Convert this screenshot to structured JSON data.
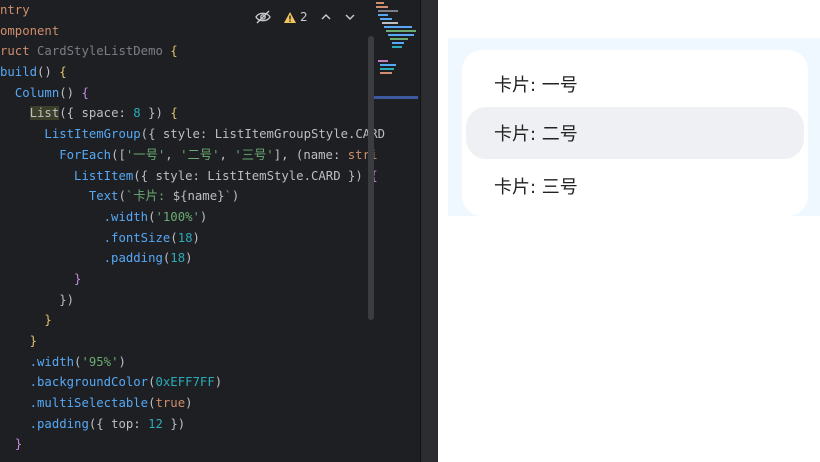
{
  "editor": {
    "toolbar": {
      "warnings_count": "2"
    },
    "lines": [
      [
        [
          "ntry",
          "kw"
        ]
      ],
      [
        [
          "omponent",
          "kw"
        ]
      ],
      [
        [
          "ruct ",
          "kw"
        ],
        [
          "CardStyleListDemo",
          "dim"
        ],
        [
          " ",
          ""
        ],
        [
          "{",
          "brace"
        ]
      ],
      [
        [
          "build",
          "fn"
        ],
        [
          "()",
          ""
        ],
        [
          " ",
          ""
        ],
        [
          "{",
          "brace"
        ]
      ],
      [
        [
          "  ",
          ""
        ],
        [
          "Column",
          "fn"
        ],
        [
          "()",
          ""
        ],
        [
          " ",
          ""
        ],
        [
          "{",
          "paren"
        ]
      ],
      [
        [
          "    ",
          ""
        ],
        [
          "List",
          "hl"
        ],
        [
          "({",
          ""
        ],
        [
          " space",
          ""
        ],
        [
          ": ",
          ""
        ],
        [
          "8",
          "num"
        ],
        [
          " })",
          ""
        ],
        [
          " ",
          ""
        ],
        [
          "{",
          "brace"
        ]
      ],
      [
        [
          "      ",
          ""
        ],
        [
          "ListItemGroup",
          "fn"
        ],
        [
          "({ ",
          ""
        ],
        [
          "style",
          ""
        ],
        [
          ": ",
          ""
        ],
        [
          "ListItemGroupStyle",
          ""
        ],
        [
          ".CARD",
          ""
        ]
      ],
      [
        [
          "        ",
          ""
        ],
        [
          "ForEach",
          "fn"
        ],
        [
          "([",
          ""
        ],
        [
          "'一号'",
          "str"
        ],
        [
          ", ",
          ""
        ],
        [
          "'二号'",
          "str"
        ],
        [
          ", ",
          ""
        ],
        [
          "'三号'",
          "str"
        ],
        [
          "], (",
          ""
        ],
        [
          "name",
          ""
        ],
        [
          ": ",
          ""
        ],
        [
          "stri",
          "kw"
        ]
      ],
      [
        [
          "          ",
          ""
        ],
        [
          "ListItem",
          "fn"
        ],
        [
          "({ ",
          ""
        ],
        [
          "style",
          ""
        ],
        [
          ": ",
          ""
        ],
        [
          "ListItemStyle",
          ""
        ],
        [
          ".CARD",
          ""
        ],
        [
          " }) ",
          ""
        ],
        [
          "{",
          "paren"
        ]
      ],
      [
        [
          "            ",
          ""
        ],
        [
          "Text",
          "fn"
        ],
        [
          "(",
          ""
        ],
        [
          "`卡片: ",
          "str"
        ],
        [
          "${name}",
          ""
        ],
        [
          "`",
          "str"
        ],
        [
          ")",
          ""
        ]
      ],
      [
        [
          "              ",
          ""
        ],
        [
          ".width",
          "fn"
        ],
        [
          "(",
          ""
        ],
        [
          "'100%'",
          "str"
        ],
        [
          ")",
          ""
        ]
      ],
      [
        [
          "              ",
          ""
        ],
        [
          ".fontSize",
          "fn"
        ],
        [
          "(",
          ""
        ],
        [
          "18",
          "num"
        ],
        [
          ")",
          ""
        ]
      ],
      [
        [
          "              ",
          ""
        ],
        [
          ".padding",
          "fn"
        ],
        [
          "(",
          ""
        ],
        [
          "18",
          "num"
        ],
        [
          ")",
          ""
        ]
      ],
      [
        [
          "          ",
          ""
        ],
        [
          "}",
          "paren"
        ]
      ],
      [
        [
          "        ",
          ""
        ],
        [
          "})",
          ""
        ]
      ],
      [
        [
          "      ",
          ""
        ],
        [
          "}",
          "brace"
        ]
      ],
      [
        [
          "    ",
          ""
        ],
        [
          "}",
          "brace"
        ]
      ],
      [
        [
          "    ",
          ""
        ],
        [
          ".width",
          "fn"
        ],
        [
          "(",
          ""
        ],
        [
          "'95%'",
          "str"
        ],
        [
          ")",
          ""
        ]
      ],
      [
        [
          "    ",
          ""
        ],
        [
          ".backgroundColor",
          "fn"
        ],
        [
          "(",
          ""
        ],
        [
          "0xEFF7FF",
          "num"
        ],
        [
          ")",
          ""
        ]
      ],
      [
        [
          "    ",
          ""
        ],
        [
          ".multiSelectable",
          "fn"
        ],
        [
          "(",
          ""
        ],
        [
          "true",
          "kw"
        ],
        [
          ")",
          ""
        ]
      ],
      [
        [
          "    ",
          ""
        ],
        [
          ".padding",
          "fn"
        ],
        [
          "({ ",
          ""
        ],
        [
          "top",
          ""
        ],
        [
          ": ",
          ""
        ],
        [
          "12",
          "num"
        ],
        [
          " })",
          ""
        ]
      ],
      [
        [
          "  ",
          ""
        ],
        [
          "}",
          "paren"
        ]
      ]
    ]
  },
  "preview": {
    "list_background": "#EFF7FF",
    "items": [
      {
        "label": "卡片: 一号",
        "selected": false
      },
      {
        "label": "卡片: 二号",
        "selected": true
      },
      {
        "label": "卡片: 三号",
        "selected": false
      }
    ]
  },
  "icons": {
    "hide": "eye-slash-icon",
    "warning": "warning-triangle-icon",
    "up": "chevron-up-icon",
    "down": "chevron-down-icon"
  }
}
